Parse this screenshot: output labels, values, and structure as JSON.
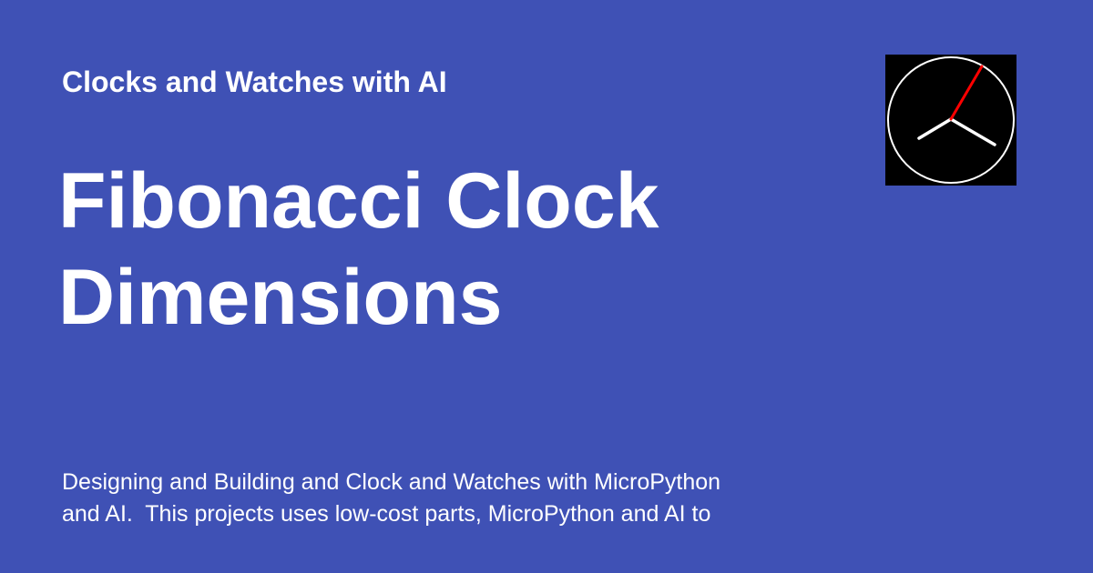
{
  "header": {
    "site_name": "Clocks and Watches with AI"
  },
  "title": {
    "line1": "Fibonacci Clock",
    "line2": "Dimensions"
  },
  "logo": {
    "icon": "analog-clock-icon",
    "background": "#000000",
    "face_color": "#ffffff",
    "second_hand_color": "#ff0000",
    "hand_color": "#ffffff"
  },
  "description": {
    "line1": "Designing and Building and Clock and Watches with MicroPython",
    "line2": "and AI.  This projects uses low-cost parts, MicroPython and AI to"
  },
  "colors": {
    "background": "#3f51b5",
    "text": "#ffffff"
  }
}
